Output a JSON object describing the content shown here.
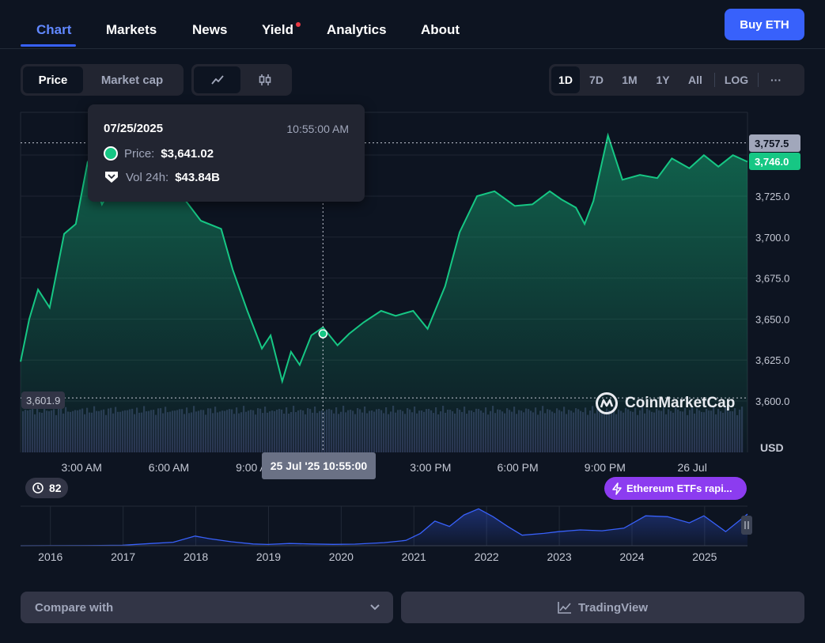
{
  "nav": {
    "tabs": [
      "Chart",
      "Markets",
      "News",
      "Yield",
      "Analytics",
      "About"
    ],
    "buy_label": "Buy ETH"
  },
  "toolbar": {
    "metric_options": [
      "Price",
      "Market cap"
    ],
    "selected_metric": "Price",
    "chart_styles": [
      "line-chart-icon",
      "candlestick-icon"
    ],
    "ranges": [
      "1D",
      "7D",
      "1M",
      "1Y",
      "All"
    ],
    "selected_range": "1D",
    "log_label": "LOG",
    "more_label": "···"
  },
  "tooltip": {
    "date": "07/25/2025",
    "time": "10:55:00 AM",
    "price_label": "Price:",
    "price_value": "$3,641.02",
    "vol_label": "Vol 24h:",
    "vol_value": "$43.84B"
  },
  "overlays": {
    "high_tag": "3,757.5",
    "current_tag": "3,746.0",
    "low_tag": "3,601.9",
    "cursor_date": "25 Jul '25 10:55:00",
    "currency": "USD",
    "brand": "CoinMarketCap",
    "history_count": "82",
    "news_pill": "Ethereum ETFs rapi..."
  },
  "colors": {
    "background": "#0d1421",
    "accent": "#3861fb",
    "up": "#16c784",
    "overview_line": "#3861fb",
    "news": "#8c3cf0"
  },
  "chart_data": [
    {
      "type": "line",
      "name": "price",
      "x_ticks": [
        "3:00 AM",
        "6:00 AM",
        "9:00 AM",
        "3:00 PM",
        "6:00 PM",
        "9:00 PM",
        "26 Jul"
      ],
      "y_ticks": [
        "3,725.0",
        "3,700.0",
        "3,675.0",
        "3,650.0",
        "3,625.0",
        "3,600.0"
      ],
      "ylim": [
        3595,
        3775
      ],
      "ylabel": "USD",
      "x_hours": [
        0,
        0.3,
        0.6,
        1,
        1.5,
        1.9,
        2.3,
        2.8,
        3.3,
        3.9,
        4.4,
        5,
        5.6,
        6.2,
        6.9,
        7.3,
        7.8,
        8.3,
        8.6,
        9,
        9.3,
        9.6,
        10,
        10.4,
        10.9,
        11.3,
        11.8,
        12.4,
        12.9,
        13.5,
        14,
        14.6,
        15.1,
        15.7,
        16.3,
        17,
        17.6,
        18.2,
        18.6,
        19.1,
        19.4,
        19.7,
        20.2,
        20.7,
        21.3,
        21.9,
        22.4,
        23,
        23.5,
        24,
        24.5,
        25
      ],
      "values": [
        3624,
        3650,
        3668,
        3657,
        3702,
        3708,
        3745,
        3720,
        3736,
        3740,
        3728,
        3732,
        3724,
        3710,
        3705,
        3680,
        3655,
        3632,
        3640,
        3612,
        3630,
        3622,
        3640,
        3645,
        3634,
        3641,
        3648,
        3655,
        3652,
        3655,
        3644,
        3670,
        3703,
        3725,
        3728,
        3719,
        3720,
        3728,
        3723,
        3718,
        3708,
        3722,
        3762,
        3735,
        3738,
        3736,
        3748,
        3742,
        3750,
        3743,
        3750,
        3746
      ],
      "volume": "uniform dark volume bars along bottom"
    },
    {
      "type": "area",
      "name": "overview",
      "x_ticks": [
        "2016",
        "2017",
        "2018",
        "2019",
        "2020",
        "2021",
        "2022",
        "2023",
        "2024",
        "2025"
      ],
      "x_years": [
        2015.6,
        2016,
        2016.5,
        2017,
        2017.4,
        2017.7,
        2018,
        2018.2,
        2018.5,
        2018.8,
        2019,
        2019.3,
        2019.6,
        2019.9,
        2020.2,
        2020.6,
        2020.9,
        2021.1,
        2021.3,
        2021.5,
        2021.7,
        2021.9,
        2022.1,
        2022.3,
        2022.5,
        2022.8,
        2023,
        2023.3,
        2023.6,
        2023.9,
        2024.2,
        2024.5,
        2024.8,
        2025,
        2025.3,
        2025.6
      ],
      "values": [
        1,
        10,
        20,
        50,
        250,
        400,
        1100,
        800,
        450,
        200,
        140,
        250,
        200,
        150,
        180,
        350,
        600,
        1400,
        2800,
        2200,
        3500,
        4200,
        3300,
        2200,
        1200,
        1400,
        1600,
        1800,
        1700,
        2000,
        3400,
        3300,
        2600,
        3400,
        1600,
        3600
      ]
    }
  ],
  "bottom": {
    "compare_label": "Compare with",
    "tradingview_label": "TradingView"
  }
}
